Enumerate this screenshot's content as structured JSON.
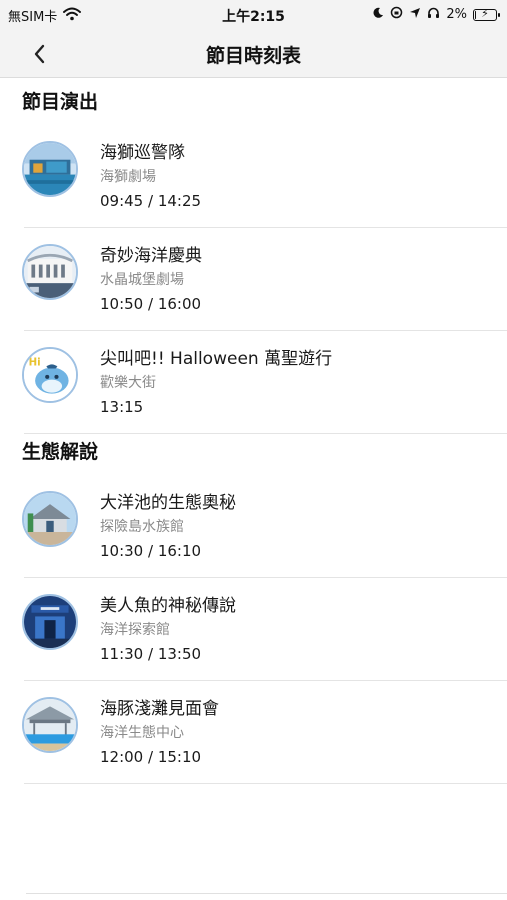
{
  "status_bar": {
    "carrier": "無SIM卡",
    "time": "上午2:15",
    "battery_percent": "2%",
    "battery_level": 0.02
  },
  "nav": {
    "title": "節目時刻表"
  },
  "sections": [
    {
      "title": "節目演出",
      "items": [
        {
          "title": "海獅巡警隊",
          "venue": "海獅劇場",
          "time": "09:45 / 14:25",
          "icon": "sea-lion-show-photo"
        },
        {
          "title": "奇妙海洋慶典",
          "venue": "水晶城堡劇場",
          "time": "10:50 / 16:00",
          "icon": "crystal-castle-photo"
        },
        {
          "title": "尖叫吧!! Halloween 萬聖遊行",
          "venue": "歡樂大街",
          "time": "13:15",
          "icon": "whale-mascot-icon"
        }
      ]
    },
    {
      "title": "生態解說",
      "items": [
        {
          "title": "大洋池的生態奧秘",
          "venue": "探險島水族館",
          "time": "10:30 / 16:10",
          "icon": "aquarium-building-photo"
        },
        {
          "title": "美人魚的神秘傳說",
          "venue": "海洋探索館",
          "time": "11:30 / 13:50",
          "icon": "exploration-hall-photo"
        },
        {
          "title": "海豚淺灘見面會",
          "venue": "海洋生態中心",
          "time": "12:00 / 15:10",
          "icon": "dolphin-pool-photo"
        }
      ]
    }
  ],
  "whale_mascot_text": "Hi"
}
